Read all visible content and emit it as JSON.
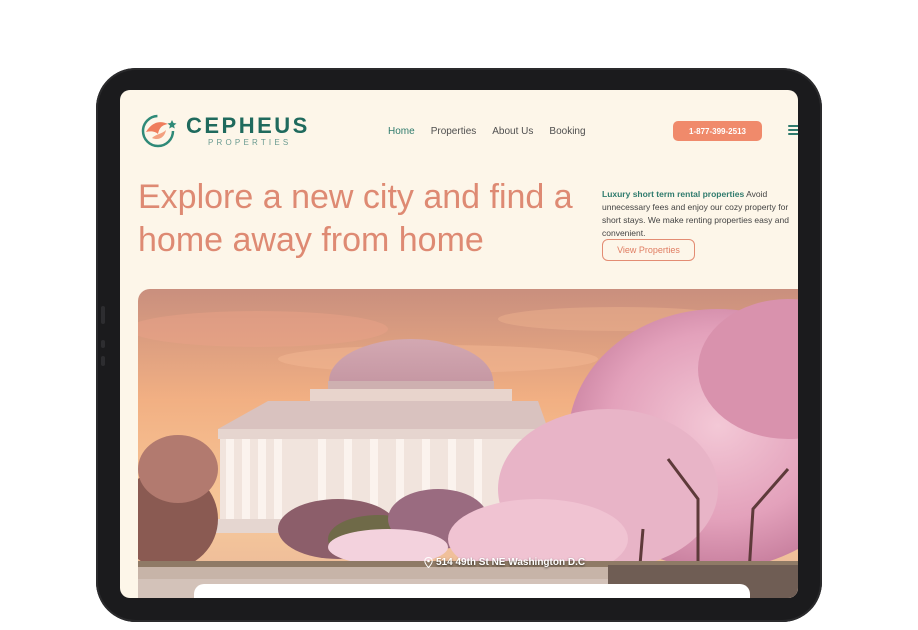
{
  "brand": {
    "name": "CEPHEUS",
    "sub": "PROPERTIES"
  },
  "nav": {
    "items": [
      "Home",
      "Properties",
      "About Us",
      "Booking"
    ],
    "active": "Home"
  },
  "header": {
    "phone": "1-877-399-2513"
  },
  "hero": {
    "headline": "Explore a new city and find a home away from home",
    "tagline_highlight": "Luxury short term rental properties",
    "tagline_rest": " Avoid unnecessary fees and enjoy our cozy property for short stays. We make renting properties easy and convenient.",
    "cta": "View Properties",
    "location": "514 49th St NE Washington D.C"
  },
  "colors": {
    "accent": "#f08a6b",
    "brand": "#1f6a5d",
    "background": "#fdf6e9"
  }
}
